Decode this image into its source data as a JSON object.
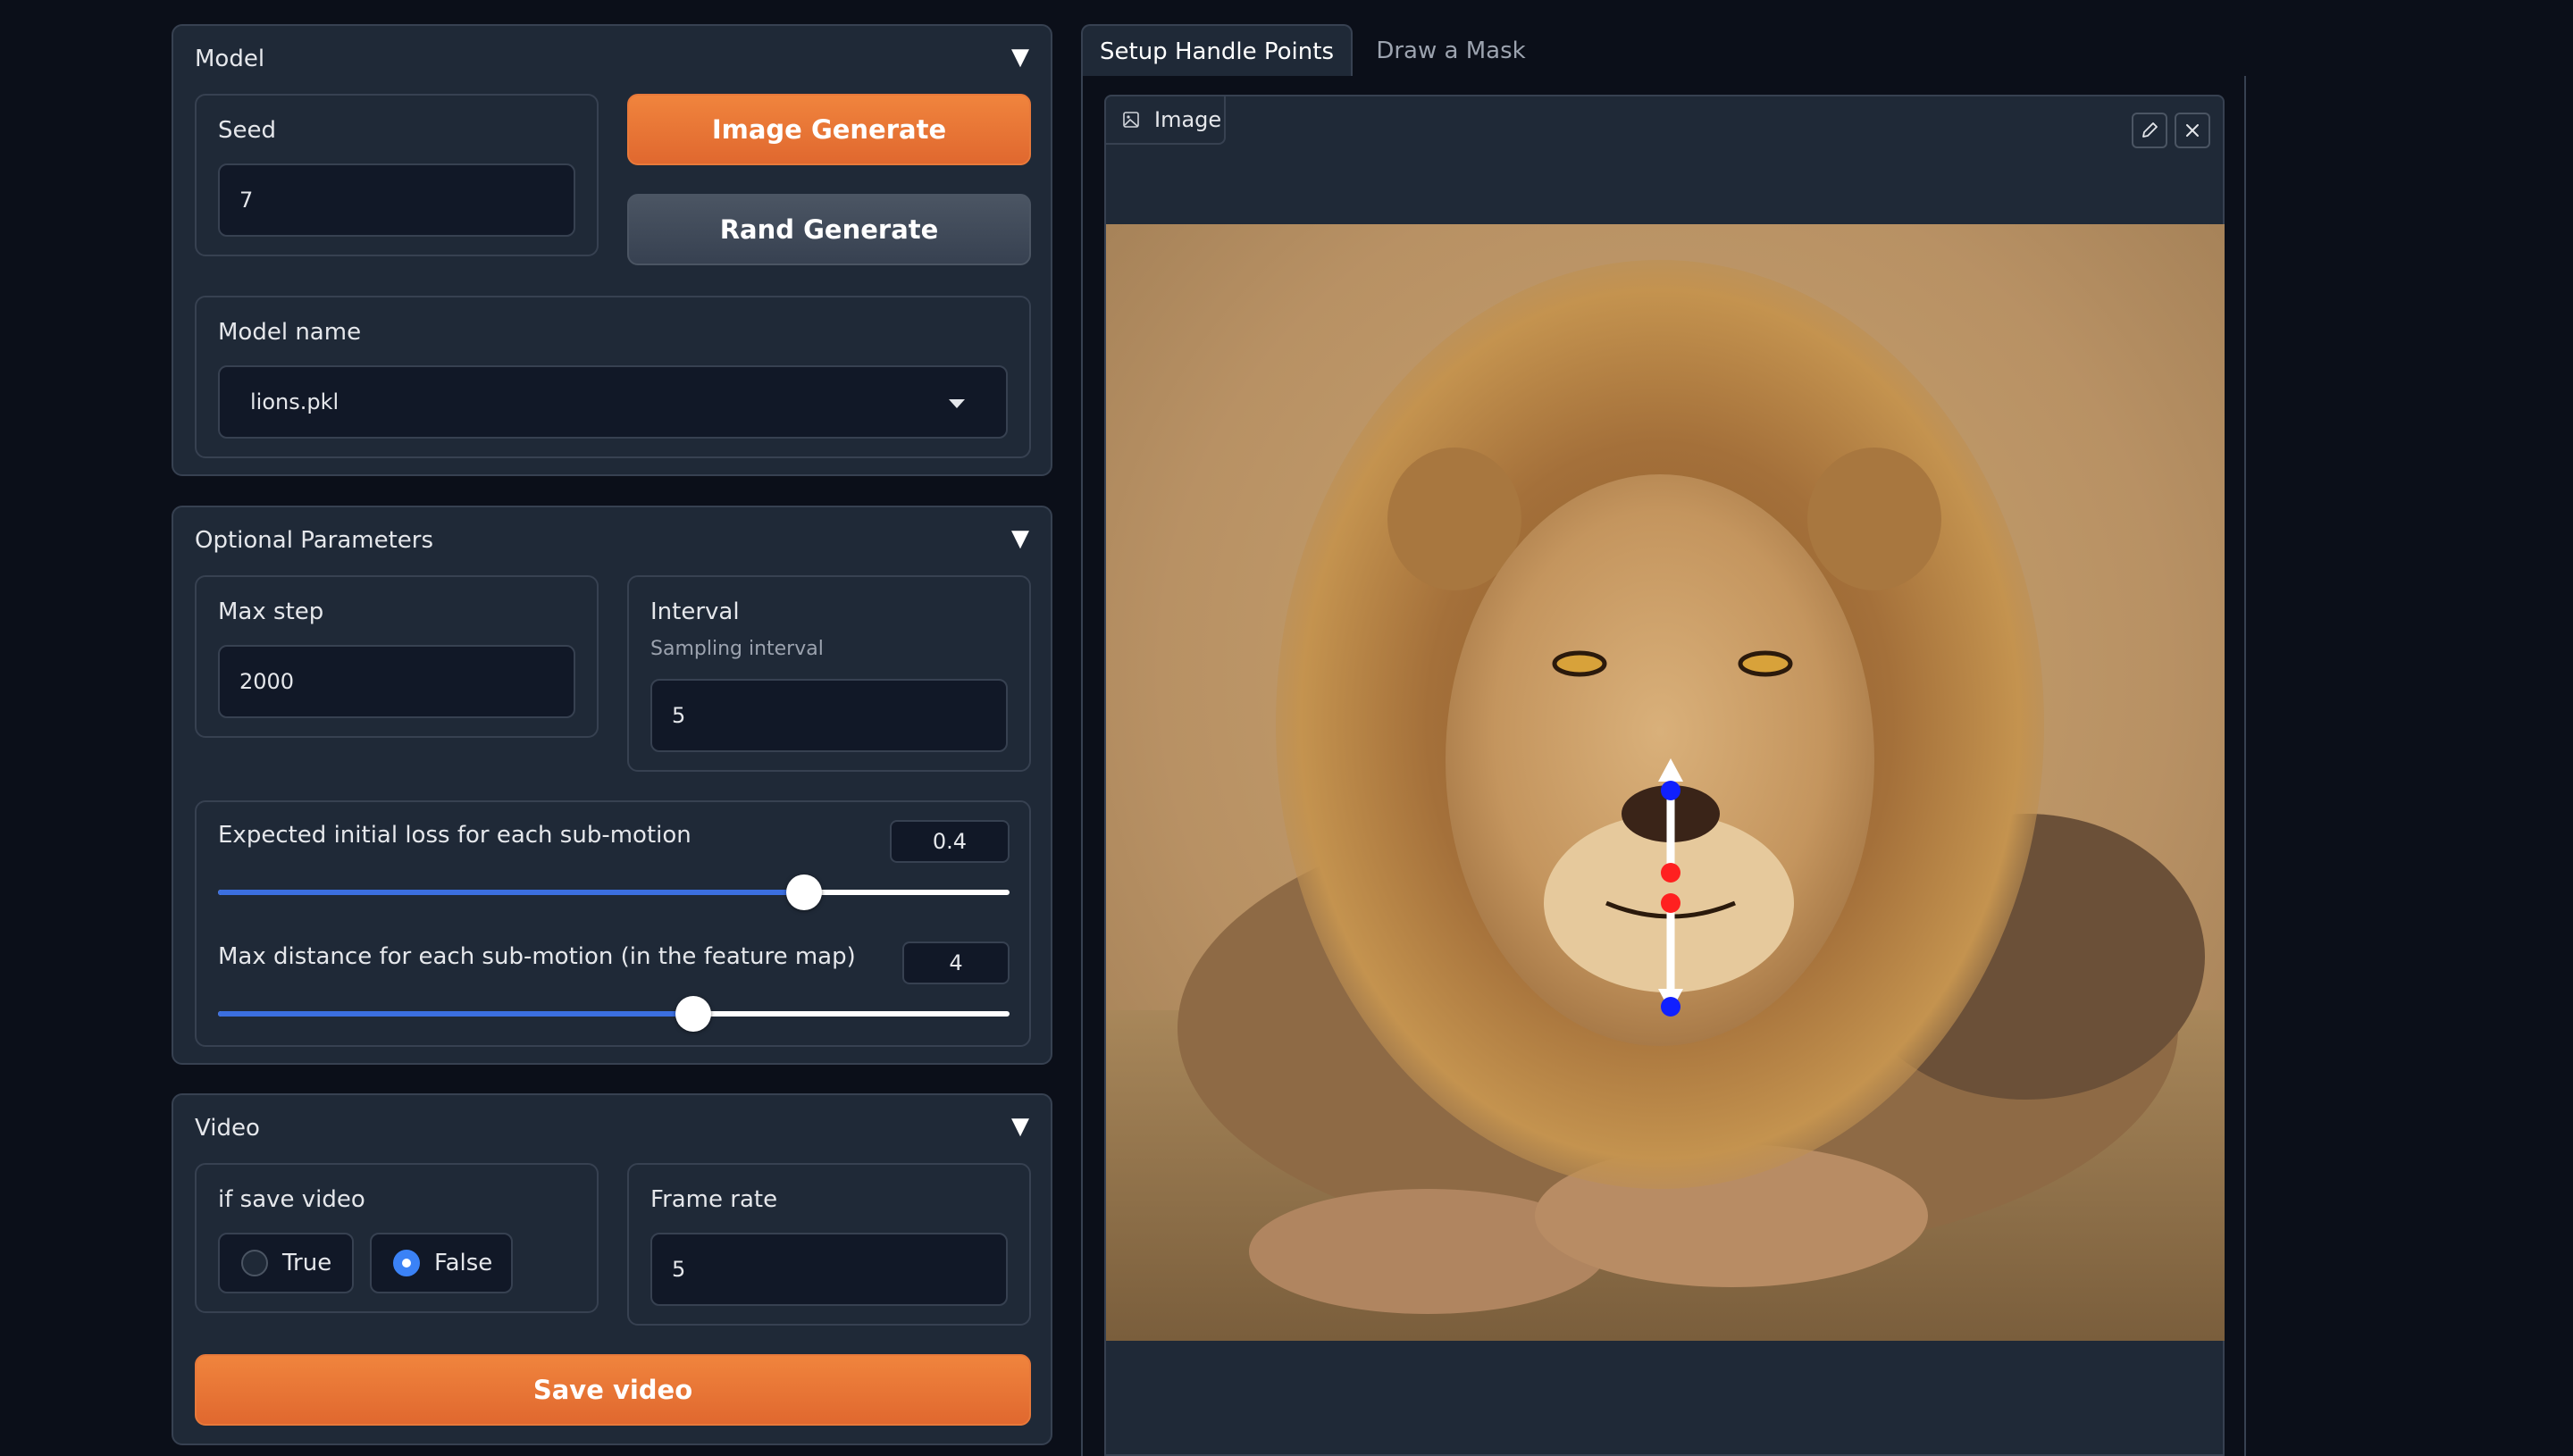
{
  "model_panel": {
    "title": "Model",
    "seed_label": "Seed",
    "seed_value": "7",
    "image_generate_label": "Image Generate",
    "rand_generate_label": "Rand Generate",
    "model_name_label": "Model name",
    "model_name_value": "lions.pkl"
  },
  "optional_panel": {
    "title": "Optional Parameters",
    "max_step_label": "Max step",
    "max_step_value": "2000",
    "interval_label": "Interval",
    "interval_info": "Sampling interval",
    "interval_value": "5",
    "loss_label": "Expected initial loss for each sub-motion",
    "loss_value": "0.4",
    "loss_slider_fraction": 0.74,
    "distance_label": "Max distance for each sub-motion (in the feature map)",
    "distance_value": "4",
    "distance_slider_fraction": 0.6
  },
  "video_panel": {
    "title": "Video",
    "save_video_label": "if save video",
    "radio_options": [
      "True",
      "False"
    ],
    "selected_option": "False",
    "frame_rate_label": "Frame rate",
    "frame_rate_value": "5",
    "save_video_button": "Save video"
  },
  "tabs": {
    "active": "Setup Handle Points",
    "inactive": "Draw a Mask"
  },
  "image_panel": {
    "label": "Image"
  },
  "colors": {
    "accent_orange": "#e8793a",
    "accent_blue": "#3b6fe0",
    "background": "#0b0f19",
    "panel": "#1f2937",
    "handle_point": "#ff2020",
    "target_point": "#1020ff"
  },
  "icons": [
    "chevron-down-icon",
    "image-icon",
    "edit-icon",
    "close-icon",
    "dropdown-caret-icon"
  ]
}
